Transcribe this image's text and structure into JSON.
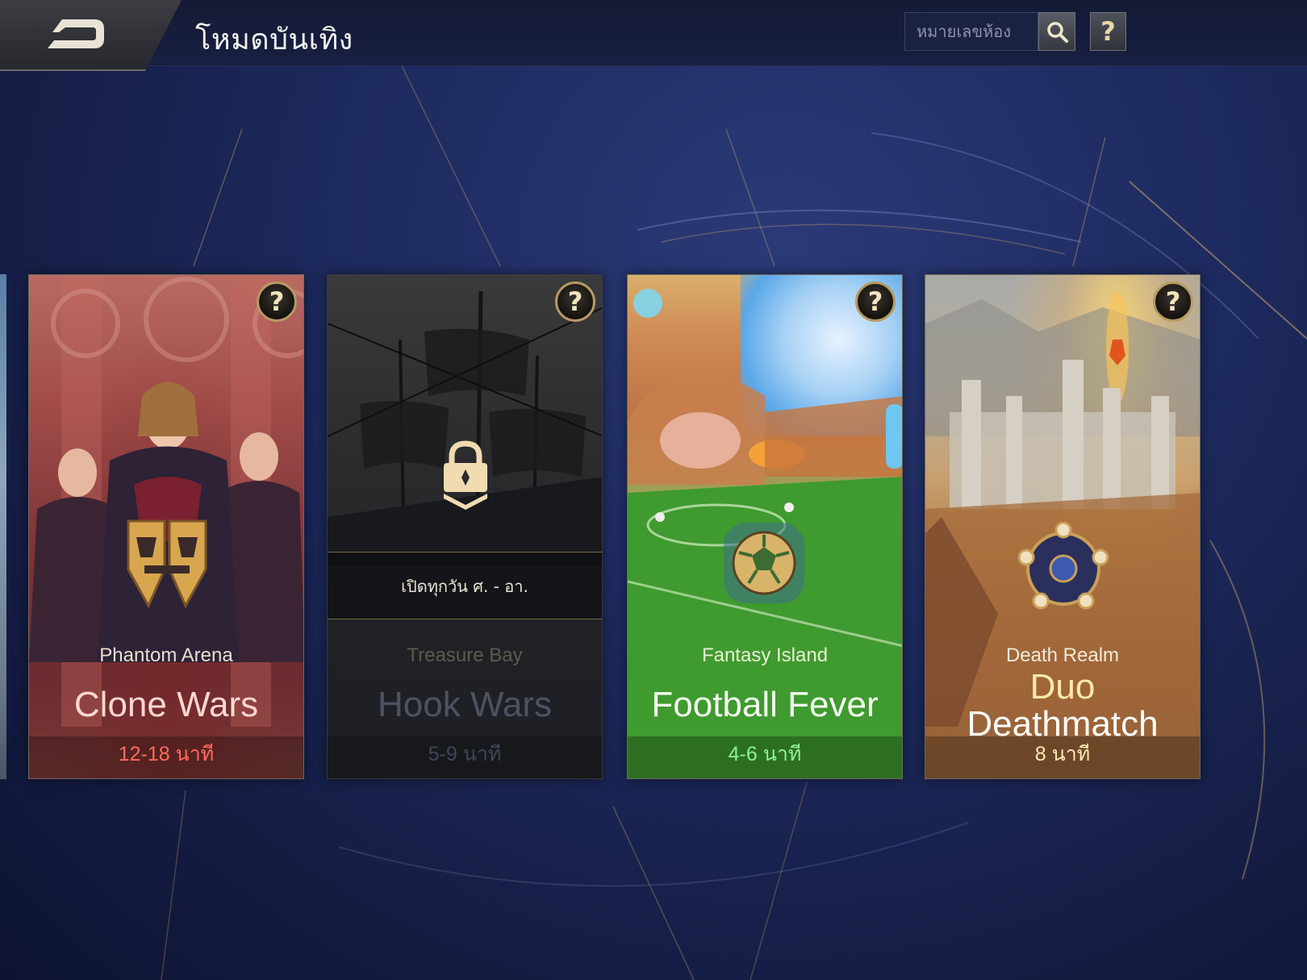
{
  "header": {
    "title": "โหมดบันเทิง",
    "room_placeholder": "หมายเลขห้อง",
    "help_label": "?"
  },
  "icons": {
    "back": "back-arrow-icon",
    "search": "search-icon",
    "help": "question-icon",
    "lock": "lock-icon"
  },
  "cards": [
    {
      "subtitle": "Phantom Arena",
      "name": "Clone Wars",
      "duration": "12-18 นาที",
      "help": "?",
      "locked": false,
      "accent": "#ff6b5e"
    },
    {
      "subtitle": "Treasure Bay",
      "name": "Hook Wars",
      "duration": "5-9 นาที",
      "help": "?",
      "locked": true,
      "lock_text": "เปิดทุกวัน ศ. - อา.",
      "accent": "#3e4657"
    },
    {
      "subtitle": "Fantasy Island",
      "name": "Football Fever",
      "duration": "4-6 นาที",
      "help": "?",
      "locked": false,
      "accent": "#8cf39a"
    },
    {
      "subtitle": "Death Realm",
      "name_line1": "Duo",
      "name_line2": "Deathmatch",
      "duration": "8 นาที",
      "help": "?",
      "locked": false,
      "accent": "#ffe8b0"
    }
  ]
}
